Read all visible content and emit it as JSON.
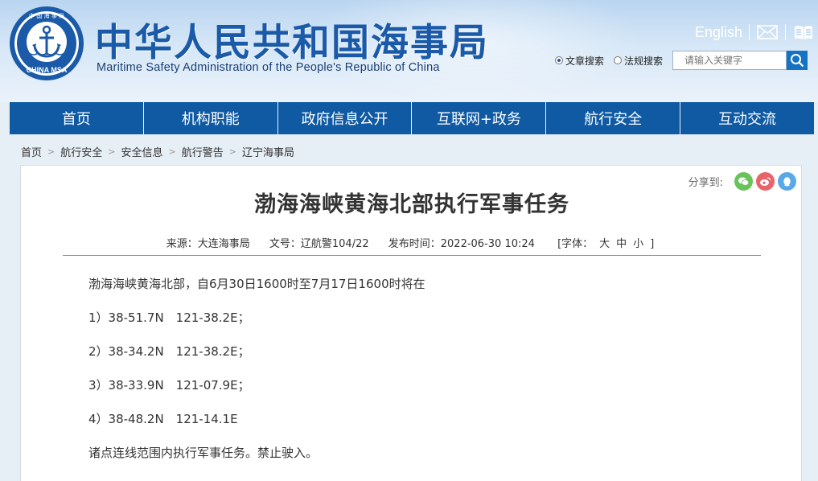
{
  "header": {
    "logo_text": "中 国 海 事 局",
    "logo_bottom": "CHINA MSA",
    "title": "中华人民共和国海事局",
    "subtitle": "Maritime Safety Administration of the People's Republic of China",
    "english_link": "English",
    "icons": [
      "mail-icon",
      "book-icon",
      "search-icon",
      "anchor-logo"
    ]
  },
  "search": {
    "options": [
      "文章搜索",
      "法规搜索"
    ],
    "selected": "文章搜索",
    "placeholder": "请输入关键字"
  },
  "nav": {
    "items": [
      "首页",
      "机构职能",
      "政府信息公开",
      "互联网+政务",
      "航行安全",
      "互动交流"
    ]
  },
  "breadcrumb": [
    "首页",
    "航行安全",
    "安全信息",
    "航行警告",
    "辽宁海事局"
  ],
  "share": {
    "label": "分享到:",
    "icons": [
      "wechat-icon",
      "weibo-icon",
      "qq-icon"
    ],
    "colors": {
      "wechat": "#6ac25c",
      "weibo": "#e8636a",
      "qq": "#59a8e8"
    }
  },
  "article": {
    "title": "渤海海峡黄海北部执行军事任务",
    "source": "来源：大连海事局",
    "doc_no": "文号：辽航警104/22",
    "published": "发布时间：2022-06-30 10:24",
    "font_label": "[字体：",
    "font_sizes": [
      "大",
      "中",
      "小"
    ],
    "font_end": "]",
    "paragraphs": [
      "渤海海峡黄海北部，自6月30日1600时至7月17日1600时将在",
      "1）38-51.7N　121-38.2E；",
      "2）38-34.2N　121-38.2E；",
      "3）38-33.9N　121-07.9E；",
      "4）38-48.2N　121-14.1E",
      "诸点连线范围内执行军事任务。禁止驶入。"
    ]
  },
  "colors": {
    "brand_blue": "#1a5aa8",
    "nav_blue": "#0f5aa3",
    "search_button": "#1673c4"
  }
}
